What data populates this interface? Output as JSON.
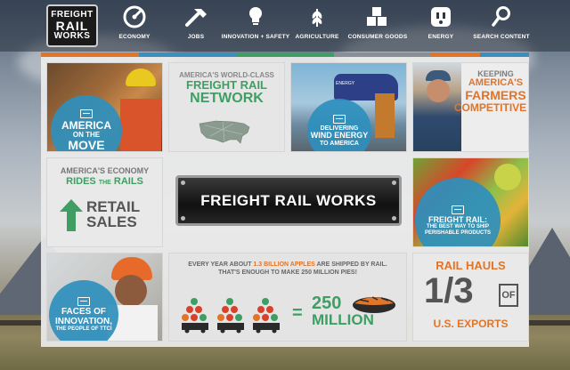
{
  "brand": {
    "line1": "FREIGHT",
    "line2": "RAIL",
    "line3": "WORKS"
  },
  "nav": [
    {
      "label": "ECONOMY",
      "icon": "economy-gauge-icon"
    },
    {
      "label": "JOBS",
      "icon": "hammer-icon"
    },
    {
      "label": "INNOVATION + SAFETY",
      "icon": "lightbulb-icon"
    },
    {
      "label": "AGRICULTURE",
      "icon": "wheat-icon"
    },
    {
      "label": "CONSUMER GOODS",
      "icon": "boxes-icon"
    },
    {
      "label": "ENERGY",
      "icon": "outlet-icon"
    },
    {
      "label": "SEARCH CONTENT",
      "icon": "search-icon"
    }
  ],
  "colorbar": [
    "#e0752a",
    "#e0752a",
    "#3a8fbf",
    "#3a8fbf",
    "#3e9e63",
    "#3e9e63",
    "#8a8f96",
    "#8a8f96",
    "#e0752a",
    "#3a8fbf"
  ],
  "tiles": {
    "america_move": {
      "line1": "AMERICA",
      "line2": "ON THE",
      "line3": "MOVE"
    },
    "network": {
      "line1": "AMERICA'S WORLD-CLASS",
      "line2": "FREIGHT RAIL",
      "line3": "NETWORK"
    },
    "wind": {
      "line1": "DELIVERING",
      "line2": "WIND ENERGY",
      "line3": "TO AMERICA",
      "truck_text": "ENERGY"
    },
    "farmers": {
      "line1": "KEEPING",
      "line2": "AMERICA'S",
      "line3": "FARMERS",
      "line4": "COMPETITIVE"
    },
    "economy": {
      "line1": "AMERICA'S ECONOMY",
      "line2a": "RIDES",
      "line2b": "THE",
      "line2c": "RAILS",
      "line3": "RETAIL",
      "line4": "SALES"
    },
    "plaque": {
      "text": "FREIGHT RAIL WORKS"
    },
    "perishable": {
      "line1": "FREIGHT RAIL:",
      "line2": "THE BEST WAY TO SHIP",
      "line3": "PERISHABLE PRODUCTS"
    },
    "faces": {
      "line1": "FACES OF",
      "line2": "INNOVATION,",
      "line3": "THE PEOPLE OF TTCI"
    },
    "apples": {
      "line1a": "EVERY YEAR ABOUT",
      "line1b": "1.3 BILLION APPLES",
      "line1c": "ARE SHIPPED BY RAIL.",
      "line2": "THAT'S ENOUGH TO MAKE 250 MILLION PIES!",
      "equals": "=",
      "num": "250",
      "unit": "MILLION"
    },
    "exports": {
      "line1": "RAIL HAULS",
      "fraction": "1/3",
      "of": "OF",
      "line3": "U.S. EXPORTS"
    }
  }
}
